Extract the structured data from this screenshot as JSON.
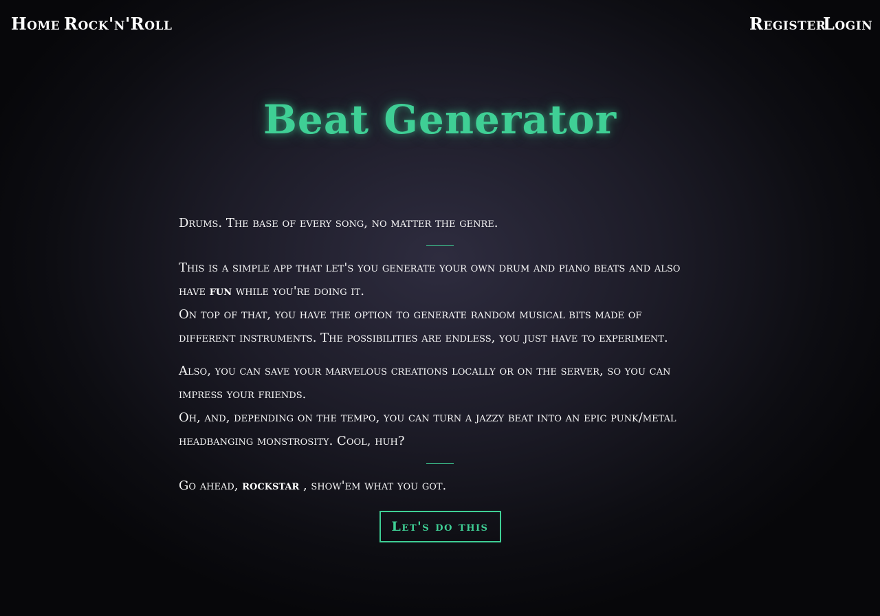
{
  "nav": {
    "home_label": "Home",
    "rock_label": "Rock'n'Roll",
    "register_label": "Register",
    "login_label": "Login"
  },
  "hero": {
    "title": "Beat Generator"
  },
  "intro": {
    "line1": "Drums. The base of every song, no matter the genre.",
    "para2_a": "This is a simple app that let's you generate your own drum and piano beats and also have ",
    "para2_fun": "fun",
    "para2_b": " while you're doing it.",
    "para3": "On top of that, you have the option to generate random musical bits made of different instruments. The possibilities are endless, you just have to experiment.",
    "para4": "Also, you can save your marvelous creations locally or on the server, so you can impress your friends.",
    "para5": "Oh, and, depending on the tempo, you can turn a jazzy beat into an epic punk/metal headbanging monstrosity. Cool, huh?",
    "closing_a": "Go ahead, ",
    "closing_rockstar": "rockstar",
    "closing_b": " , show'em what you got."
  },
  "cta": {
    "label": "Let's do this"
  },
  "colors": {
    "accent": "#3fcf95",
    "background": "#1d1c28",
    "text": "#f6f6f6"
  }
}
